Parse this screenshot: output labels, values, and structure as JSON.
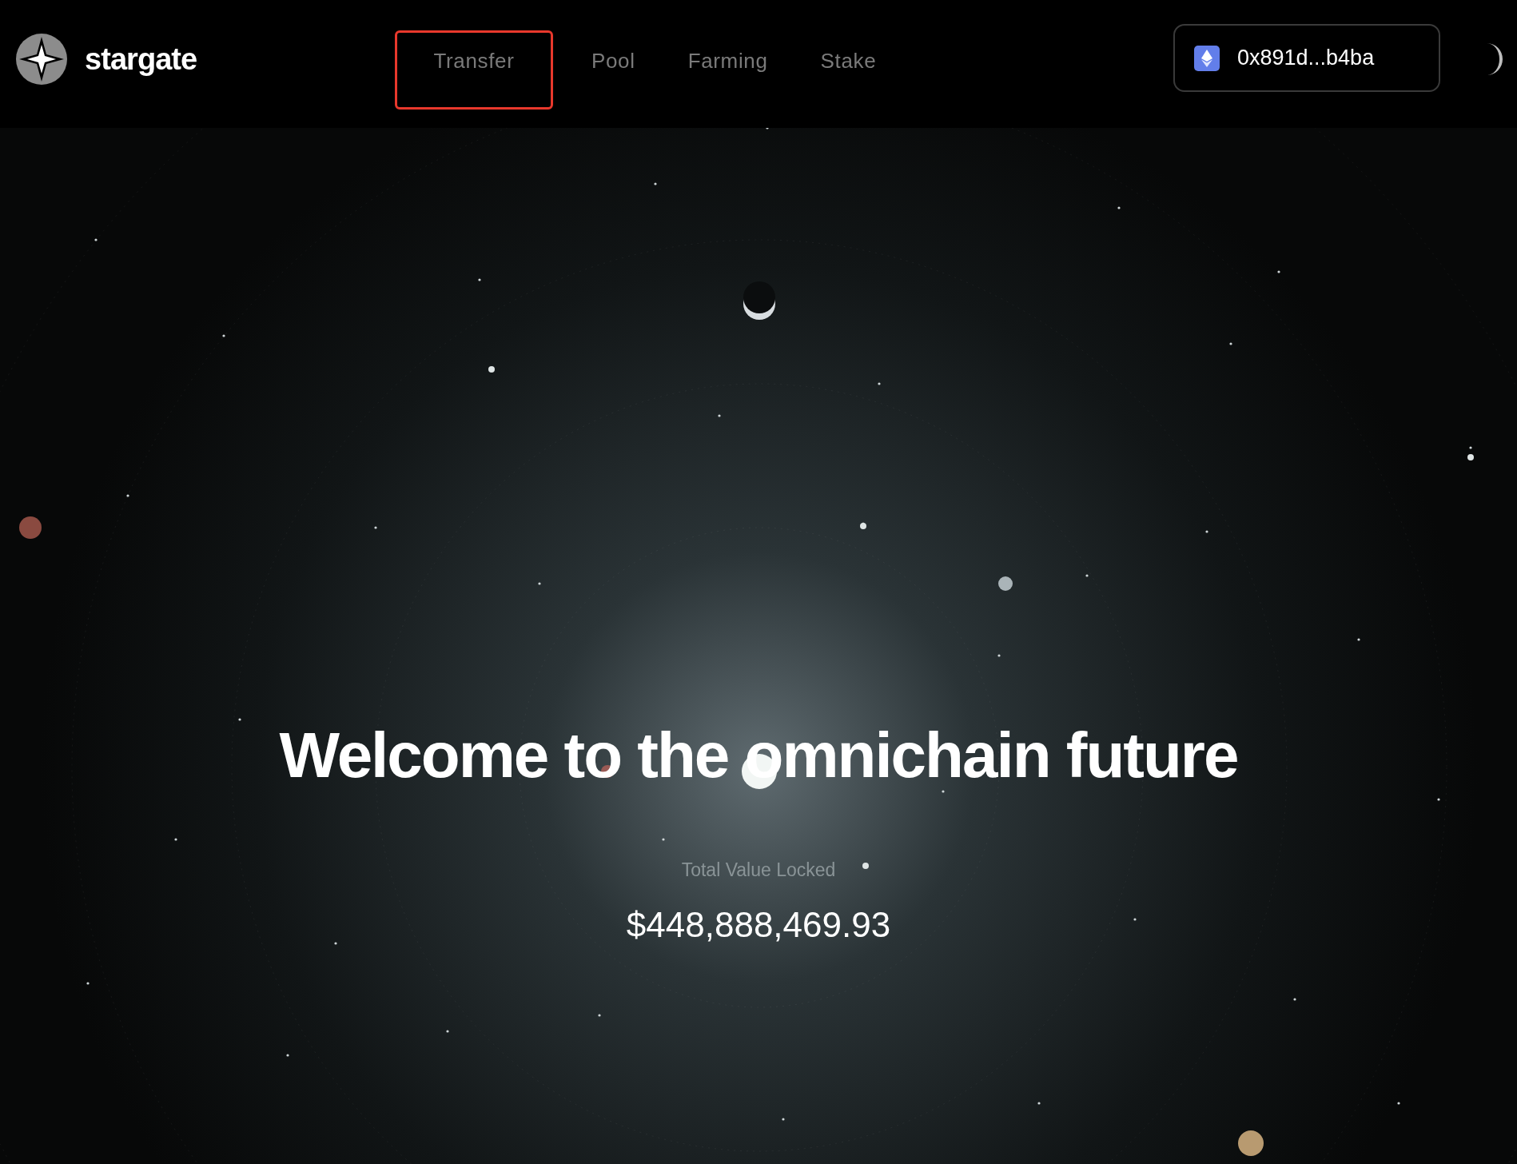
{
  "brand": {
    "name": "stargate"
  },
  "nav": [
    {
      "label": "Transfer",
      "highlighted": true
    },
    {
      "label": "Pool",
      "highlighted": false
    },
    {
      "label": "Farming",
      "highlighted": false
    },
    {
      "label": "Stake",
      "highlighted": false
    }
  ],
  "wallet": {
    "address": "0x891d...b4ba"
  },
  "hero": {
    "title": "Welcome to the omnichain future",
    "tvl_label": "Total Value Locked",
    "tvl_value": "$448,888,469.93"
  }
}
